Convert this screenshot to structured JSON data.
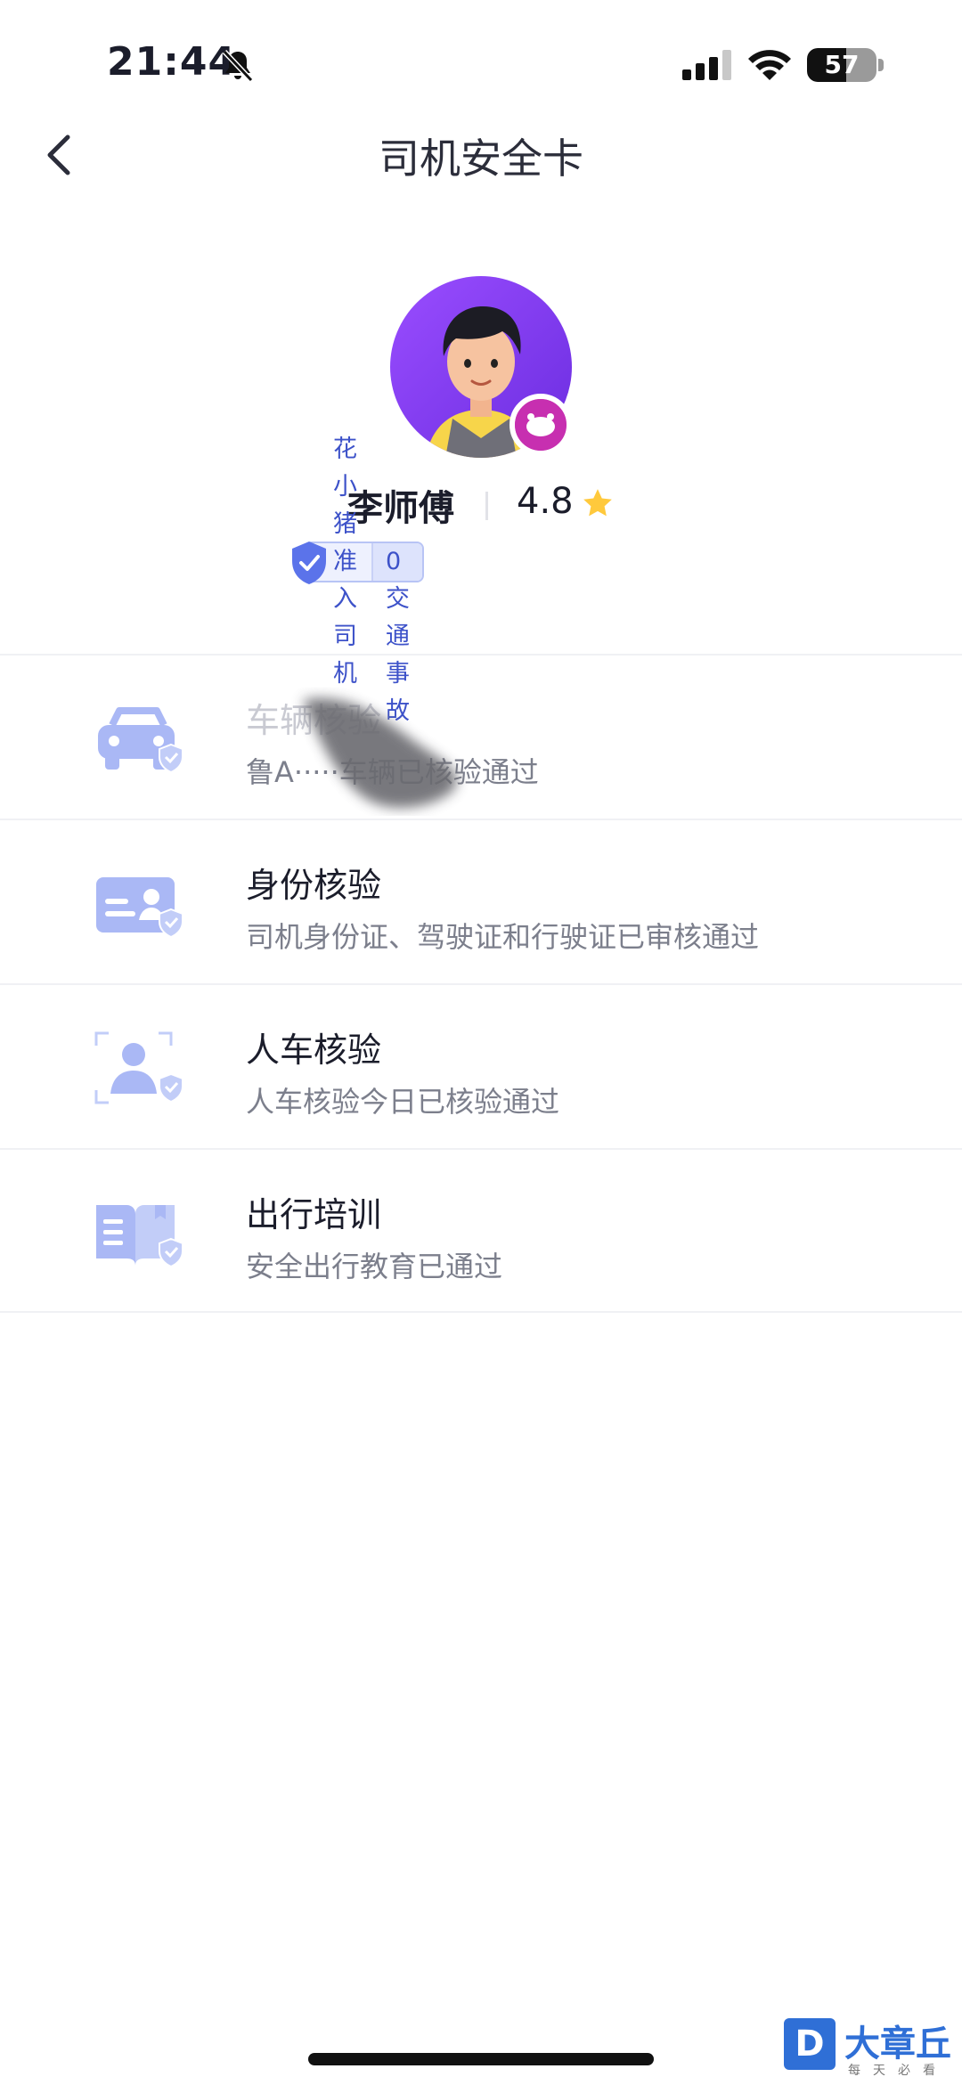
{
  "status_bar": {
    "time": "21:44",
    "battery": "57",
    "battery_level": 0.57
  },
  "nav": {
    "title": "司机安全卡"
  },
  "driver": {
    "name": "李师傅",
    "rating": "4.8",
    "tag_main": "花小猪准入司机",
    "tag_sub": "0交通事故"
  },
  "items": [
    {
      "title": "车辆核验",
      "desc": "鲁A·····车辆已核验通过",
      "icon": "car-shield-icon"
    },
    {
      "title": "身份核验",
      "desc": "司机身份证、驾驶证和行驶证已审核通过",
      "icon": "id-card-shield-icon"
    },
    {
      "title": "人车核验",
      "desc": "人车核验今日已核验通过",
      "icon": "face-scan-shield-icon"
    },
    {
      "title": "出行培训",
      "desc": "安全出行教育已通过",
      "icon": "book-shield-icon"
    }
  ],
  "watermark": {
    "logo": "D",
    "name": "大章丘",
    "slogan": "每天必看"
  },
  "colors": {
    "accent": "#3d52c9",
    "avatar": "#8a3ff5",
    "badge": "#c72fb0",
    "icon": "#aab8f5"
  }
}
